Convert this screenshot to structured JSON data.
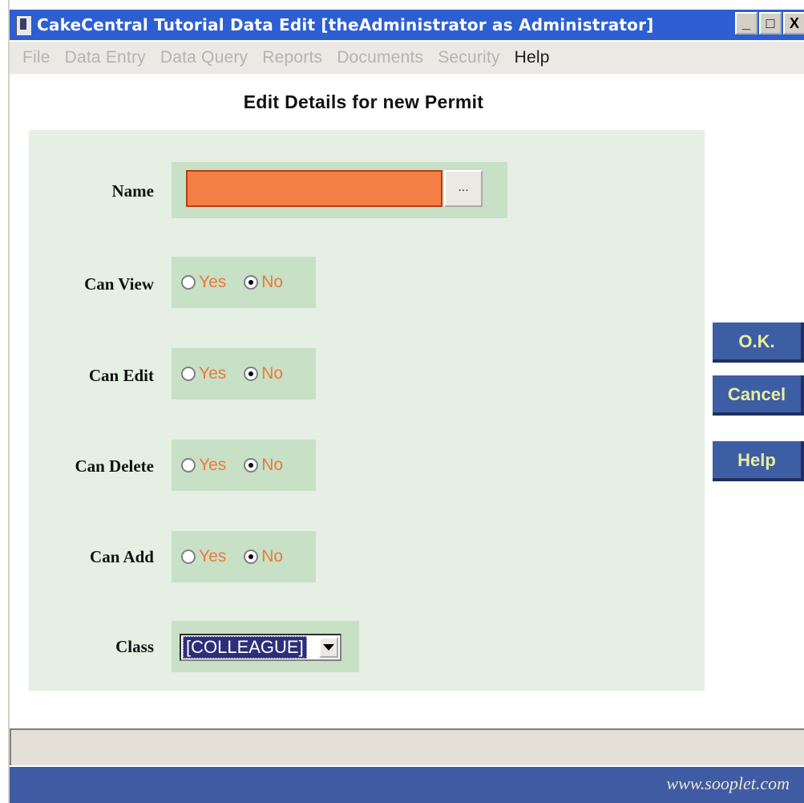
{
  "window": {
    "title": "CakeCentral Tutorial Data Edit [theAdministrator as Administrator]",
    "controls": {
      "minimize": "_",
      "maximize": "□",
      "close": "X"
    }
  },
  "menu": [
    {
      "label": "File",
      "enabled": false
    },
    {
      "label": "Data Entry",
      "enabled": false
    },
    {
      "label": "Data Query",
      "enabled": false
    },
    {
      "label": "Reports",
      "enabled": false
    },
    {
      "label": "Documents",
      "enabled": false
    },
    {
      "label": "Security",
      "enabled": false
    },
    {
      "label": "Help",
      "enabled": true
    }
  ],
  "form": {
    "title": "Edit Details for new Permit",
    "name": {
      "label": "Name",
      "value": "",
      "browse_label": "..."
    },
    "can_view": {
      "label": "Can View",
      "yes": "Yes",
      "no": "No",
      "selected": "No"
    },
    "can_edit": {
      "label": "Can Edit",
      "yes": "Yes",
      "no": "No",
      "selected": "No"
    },
    "can_delete": {
      "label": "Can Delete",
      "yes": "Yes",
      "no": "No",
      "selected": "No"
    },
    "can_add": {
      "label": "Can Add",
      "yes": "Yes",
      "no": "No",
      "selected": "No"
    },
    "class": {
      "label": "Class",
      "value": "[COLLEAGUE]"
    }
  },
  "actions": {
    "ok": "O.K.",
    "cancel": "Cancel",
    "help": "Help"
  },
  "status": {
    "text": ""
  },
  "footer": {
    "text": "www.sooplet.com"
  },
  "colors": {
    "titlebar": "#2d5fd3",
    "panel": "#e5efe4",
    "field_box": "#c7e0c6",
    "name_input": "#f47f45",
    "radio_label": "#f07838",
    "action_button": "#3d5ea5",
    "action_text": "#e9ee9a",
    "footer": "#3f5ba3"
  }
}
